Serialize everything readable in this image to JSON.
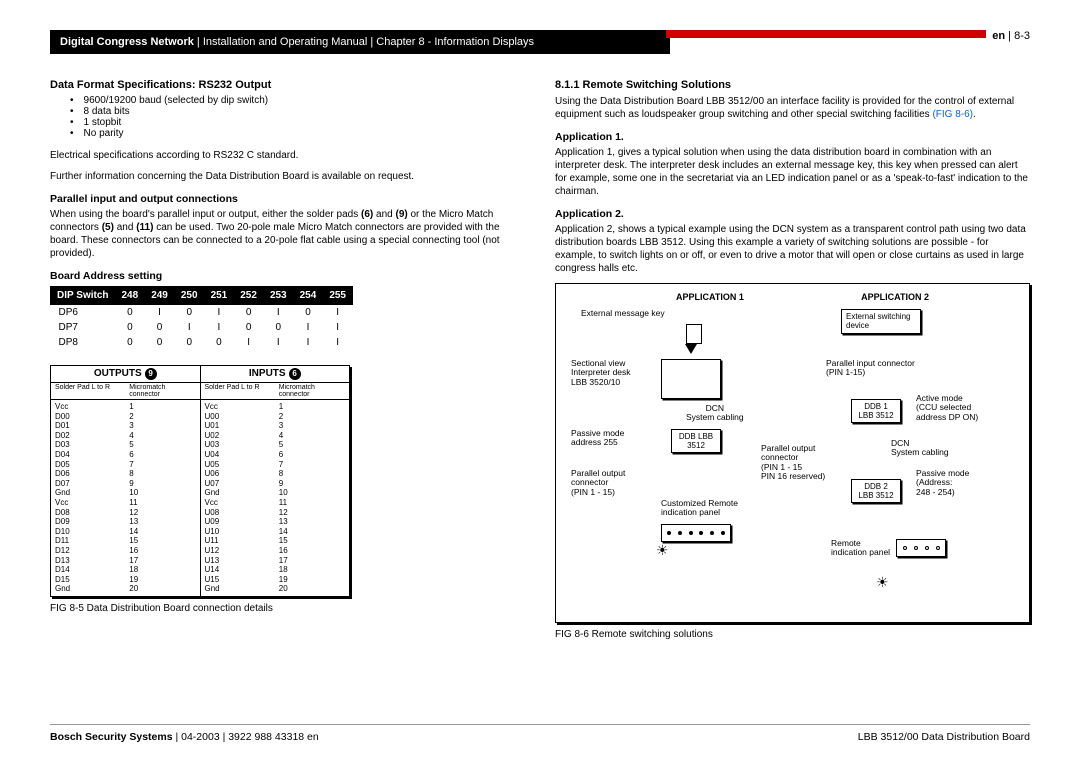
{
  "header": {
    "title_bold": "Digital Congress Network",
    "title_rest": " | Installation and Operating Manual | Chapter 8 - Information Displays",
    "page_lang": "en",
    "page_num": " | 8-3"
  },
  "left": {
    "h1": "Data Format Specifications: RS232 Output",
    "bullets": [
      "9600/19200 baud (selected by dip switch)",
      "8 data bits",
      "1 stopbit",
      "No parity"
    ],
    "p1": "Electrical specifications according to RS232 C standard.",
    "p2": "Further information concerning the Data Distribution Board is available on request.",
    "h2": "Parallel input and output connections",
    "p3a": "When using the board's parallel input or output, either the solder pads ",
    "b6": "(6)",
    "p3b": " and ",
    "b9": "(9)",
    "p3c": " or the Micro Match connectors ",
    "b5": "(5)",
    "p3d": " and ",
    "b11": "(11)",
    "p3e": " can be used. Two 20-pole male Micro Match connectors are provided with the board. These connectors can be connected to a 20-pole flat cable using a special connecting tool (not provided).",
    "h3": "Board Address setting",
    "dip_header": [
      "DIP Switch",
      "248",
      "249",
      "250",
      "251",
      "252",
      "253",
      "254",
      "255"
    ],
    "dip_rows": [
      [
        "DP6",
        "0",
        "I",
        "0",
        "I",
        "0",
        "I",
        "0",
        "I"
      ],
      [
        "DP7",
        "0",
        "0",
        "I",
        "I",
        "0",
        "0",
        "I",
        "I"
      ],
      [
        "DP8",
        "0",
        "0",
        "0",
        "0",
        "I",
        "I",
        "I",
        "I"
      ]
    ],
    "outputs_label": "OUTPUTS",
    "outputs_num": "9",
    "inputs_label": "INPUTS",
    "inputs_num": "6",
    "sub_labels": [
      "Solder Pad L to R",
      "Micromatch connector",
      "Solder Pad L to R",
      "Micromatch connector"
    ],
    "io_out_names": [
      "Vcc",
      "D00",
      "D01",
      "D02",
      "D03",
      "D04",
      "D05",
      "D06",
      "D07",
      "Gnd",
      "Vcc",
      "D08",
      "D09",
      "D10",
      "D11",
      "D12",
      "D13",
      "D14",
      "D15",
      "Gnd"
    ],
    "io_out_nums": [
      "1",
      "2",
      "3",
      "4",
      "5",
      "6",
      "7",
      "8",
      "9",
      "10",
      "11",
      "12",
      "13",
      "14",
      "15",
      "16",
      "17",
      "18",
      "19",
      "20"
    ],
    "io_in_names": [
      "Vcc",
      "U00",
      "U01",
      "U02",
      "U03",
      "U04",
      "U05",
      "U06",
      "U07",
      "Gnd",
      "Vcc",
      "U08",
      "U09",
      "U10",
      "U11",
      "U12",
      "U13",
      "U14",
      "U15",
      "Gnd"
    ],
    "io_in_nums": [
      "1",
      "2",
      "3",
      "4",
      "5",
      "6",
      "7",
      "8",
      "9",
      "10",
      "11",
      "12",
      "13",
      "14",
      "15",
      "16",
      "17",
      "18",
      "19",
      "20"
    ],
    "fig85": "FIG 8-5  Data Distribution Board connection details"
  },
  "right": {
    "h1": "8.1.1   Remote Switching Solutions",
    "p1a": "Using the Data Distribution Board LBB 3512/00 an interface facility is provided for the control of external equipment such as loudspeaker group switching and other special switching facilities ",
    "p1link": "(FIG 8-6)",
    "p1b": ".",
    "h2": "Application 1.",
    "p2": "Application 1, gives a typical solution when using the data distribution board in combination with an interpreter desk. The interpreter desk includes an external message key, this key when pressed can alert for example, some one in the secretariat via an LED indication panel or as a 'speak-to-fast' indication to the chairman.",
    "h3": "Application 2.",
    "p3": "Application 2, shows a typical example using the DCN system as a transparent control path using two data distribution boards LBB 3512. Using this example a variety of switching solutions are possible - for example, to switch lights on or off, or even to drive a motor that will open or close curtains as used in large congress halls etc.",
    "app1": "APPLICATION 1",
    "app2": "APPLICATION 2",
    "d_extmsg": "External message key",
    "d_section": "Sectional view\nInterpreter desk\nLBB 3520/10",
    "d_dcn": "DCN\nSystem cabling",
    "d_passive": "Passive mode\naddress 255",
    "d_ddb": "DDB\nLBB 3512",
    "d_parout": "Parallel output\nconnector\n(PIN 1 - 15)",
    "d_custom": "Customized Remote\nindication panel",
    "d_extsw": "External switching\ndevice",
    "d_parin": "Parallel input connector\n(PIN 1-15)",
    "d_ddb1": "DDB 1\nLBB 3512",
    "d_active": "Active mode\n(CCU selected\naddress DP ON)",
    "d_parout2": "Parallel output\nconnector\n(PIN 1 - 15\nPIN 16 reserved)",
    "d_ddb2": "DDB 2\nLBB 3512",
    "d_dcn2": "DCN\nSystem cabling",
    "d_passive2": "Passive mode\n(Address:\n248 - 254)",
    "d_remote": "Remote\nindication panel",
    "fig86": "FIG 8-6  Remote switching solutions"
  },
  "footer": {
    "left_bold": "Bosch Security Systems",
    "left_rest": " | 04-2003 | 3922 988 43318 en",
    "right": "LBB 3512/00 Data Distribution Board"
  }
}
